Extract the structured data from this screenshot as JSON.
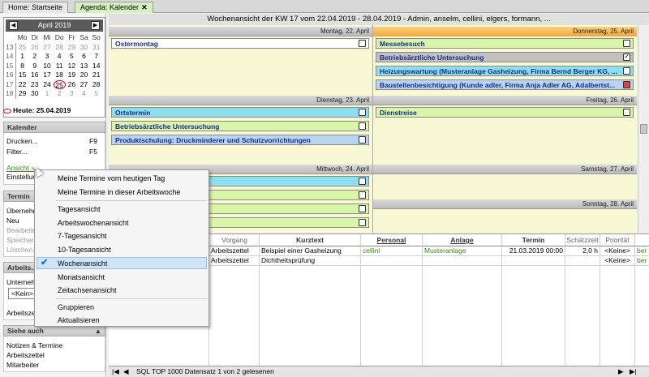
{
  "tabs": [
    {
      "label": "Home: Startseite"
    },
    {
      "label": "Agenda: Kalender",
      "close": "✕"
    }
  ],
  "calendar": {
    "month_label": "April 2019",
    "weekday_headers": [
      "Mo",
      "Di",
      "Mi",
      "Do",
      "Fr",
      "Sa",
      "So"
    ],
    "weeks": [
      {
        "wk": "13",
        "days": [
          "25",
          "26",
          "27",
          "28",
          "29",
          "30",
          "31"
        ]
      },
      {
        "wk": "14",
        "days": [
          "1",
          "2",
          "3",
          "4",
          "5",
          "6",
          "7"
        ]
      },
      {
        "wk": "15",
        "days": [
          "8",
          "9",
          "10",
          "11",
          "12",
          "13",
          "14"
        ]
      },
      {
        "wk": "16",
        "days": [
          "15",
          "16",
          "17",
          "18",
          "19",
          "20",
          "21"
        ]
      },
      {
        "wk": "17",
        "days": [
          "22",
          "23",
          "24",
          "25",
          "26",
          "27",
          "28"
        ]
      },
      {
        "wk": "18",
        "days": [
          "29",
          "30",
          "1",
          "2",
          "3",
          "4",
          "5"
        ]
      }
    ],
    "today_label": "Heute: 25.04.2019"
  },
  "sidebar": {
    "kalender_title": "Kalender",
    "kalender_items": [
      {
        "label": "Drucken...",
        "shortcut": "F9"
      },
      {
        "label": "Filter...",
        "shortcut": "F5"
      },
      {
        "label": "Ansicht »"
      },
      {
        "label": "Einstellun..."
      }
    ],
    "termin_title": "Termin",
    "termin_items": [
      "Übernehm...",
      "Neu",
      "Bearbeite...",
      "Speicher...",
      "Löschen..."
    ],
    "arbeits_title": "Arbeits...",
    "arbeits_label": "Unterneh...",
    "arbeits_select": "<Kein>",
    "arbeits_label2": "Arbeitsze...",
    "siehe_title": "Siehe auch",
    "siehe_items": [
      "Notizen & Termine",
      "Arbeitszettel",
      "Mitarbeiter"
    ]
  },
  "main": {
    "title": "Wochenansicht der KW 17 vom 22.04.2019 - 28.04.2019 - Admin, anselm, cellini, elgers, formann, ...",
    "days": {
      "mon": "Montag, 22. April",
      "tue": "Dienstag, 23. April",
      "wed": "Mittwoch, 24. April",
      "thu": "Donnerstag, 25. April",
      "fri": "Freitag, 26. April",
      "sat": "Samstag, 27. April",
      "sun": "Sonntag, 28. April"
    },
    "appointments": {
      "mon1": "Ostermontag",
      "tue1": "Ortstermin",
      "tue2": "Betriebsärztliche Untersuchung",
      "tue3": "Produktschulung: Druckminderer und Schutzvorrichtungen",
      "thu1": "Messebesuch",
      "thu2": "Betriebsärztliche Untersuchung",
      "thu3": "Heizungswartung (Musteranlage Gasheizung, Firma Bernd Berger KG, ...",
      "thu4": "Baustellenbesichtigung (Kunde adler, Firma Anja Adler AG, Adalbertst...",
      "fri1": "Dienstreise"
    }
  },
  "table": {
    "headers": [
      "Vorgang",
      "Kurztext",
      "Personal",
      "Anlage",
      "Termin",
      "Schätzzeit",
      "Priorität"
    ],
    "rows": [
      {
        "vorgang": "Arbeitszettel",
        "kurztext": "Beispiel einer Gasheizung",
        "personal": "cellini",
        "anlage": "Musteranlage",
        "termin": "21.03.2019 00:00",
        "schaetz": "2,0 h",
        "prio": "<Keine>",
        "extra": "ber"
      },
      {
        "vorgang": "Arbeitszettel",
        "kurztext": "Dichtheitsprüfung",
        "personal": "",
        "anlage": "",
        "termin": "",
        "schaetz": "",
        "prio": "<Keine>",
        "extra": "ber"
      }
    ],
    "status": "SQL TOP 1000 Datensatz 1 von 2 gelesenen"
  },
  "context_menu": {
    "items": [
      "Meine Termine vom heutigen Tag",
      "Meine Termine in dieser Arbeitswoche",
      "Tagesansicht",
      "Arbeitswochenansicht",
      "7-Tagesansicht",
      "10-Tagesansicht",
      "Wochenansicht",
      "Monatsansicht",
      "Zeitachsenansicht",
      "Gruppieren",
      "Aktualisieren"
    ],
    "checked": "✔"
  }
}
